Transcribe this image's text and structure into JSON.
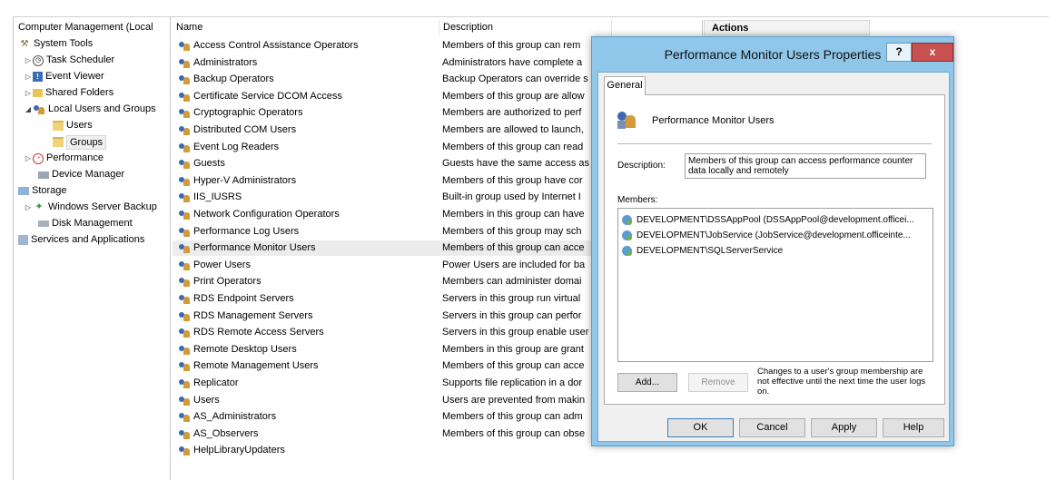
{
  "tree": {
    "root": "Computer Management (Local",
    "system_tools": "System Tools",
    "task_scheduler": "Task Scheduler",
    "event_viewer": "Event Viewer",
    "shared_folders": "Shared Folders",
    "local_users_groups": "Local Users and Groups",
    "users": "Users",
    "groups": "Groups",
    "performance": "Performance",
    "device_manager": "Device Manager",
    "storage": "Storage",
    "windows_server_backup": "Windows Server Backup",
    "disk_management": "Disk Management",
    "services_apps": "Services and Applications"
  },
  "list": {
    "col_name": "Name",
    "col_description": "Description",
    "rows": [
      {
        "name": "Access Control Assistance Operators",
        "description": "Members of this group can rem"
      },
      {
        "name": "Administrators",
        "description": "Administrators have complete a"
      },
      {
        "name": "Backup Operators",
        "description": "Backup Operators can override s"
      },
      {
        "name": "Certificate Service DCOM Access",
        "description": "Members of this group are allow"
      },
      {
        "name": "Cryptographic Operators",
        "description": "Members are authorized to perf"
      },
      {
        "name": "Distributed COM Users",
        "description": "Members are allowed to launch,"
      },
      {
        "name": "Event Log Readers",
        "description": "Members of this group can read"
      },
      {
        "name": "Guests",
        "description": "Guests have the same access as"
      },
      {
        "name": "Hyper-V Administrators",
        "description": "Members of this group have cor"
      },
      {
        "name": "IIS_IUSRS",
        "description": "Built-in group used by Internet I"
      },
      {
        "name": "Network Configuration Operators",
        "description": "Members in this group can have"
      },
      {
        "name": "Performance Log Users",
        "description": "Members of this group may sch"
      },
      {
        "name": "Performance Monitor Users",
        "description": "Members of this group can acce"
      },
      {
        "name": "Power Users",
        "description": "Power Users are included for ba"
      },
      {
        "name": "Print Operators",
        "description": "Members can administer domai"
      },
      {
        "name": "RDS Endpoint Servers",
        "description": "Servers in this group run virtual"
      },
      {
        "name": "RDS Management Servers",
        "description": "Servers in this group can perfor"
      },
      {
        "name": "RDS Remote Access Servers",
        "description": "Servers in this group enable user"
      },
      {
        "name": "Remote Desktop Users",
        "description": "Members in this group are grant"
      },
      {
        "name": "Remote Management Users",
        "description": "Members of this group can acce"
      },
      {
        "name": "Replicator",
        "description": "Supports file replication in a dor"
      },
      {
        "name": "Users",
        "description": "Users are prevented from makin"
      },
      {
        "name": "AS_Administrators",
        "description": "Members of this group can adm"
      },
      {
        "name": "AS_Observers",
        "description": "Members of this group can obse"
      },
      {
        "name": "HelpLibraryUpdaters",
        "description": ""
      }
    ]
  },
  "actions": {
    "title": "Actions"
  },
  "dialog": {
    "title": "Performance Monitor Users Properties",
    "help_glyph": "?",
    "close_glyph": "x",
    "tab_general": "General",
    "group_name": "Performance Monitor Users",
    "description_label": "Description:",
    "description_value": "Members of this group can access performance counter data locally and remotely",
    "members_label": "Members:",
    "members": [
      "DEVELOPMENT\\DSSAppPool (DSSAppPool@development.officei...",
      "DEVELOPMENT\\JobService (JobService@development.officeinte...",
      "DEVELOPMENT\\SQLServerService"
    ],
    "add_label": "Add...",
    "remove_label": "Remove",
    "note": "Changes to a user's group membership are not effective until the next time the user logs on.",
    "ok_label": "OK",
    "cancel_label": "Cancel",
    "apply_label": "Apply",
    "help_label": "Help"
  },
  "colors": {
    "selection": "#ececec",
    "dialog_frame": "#8fc7ea",
    "close_button": "#c75050"
  }
}
